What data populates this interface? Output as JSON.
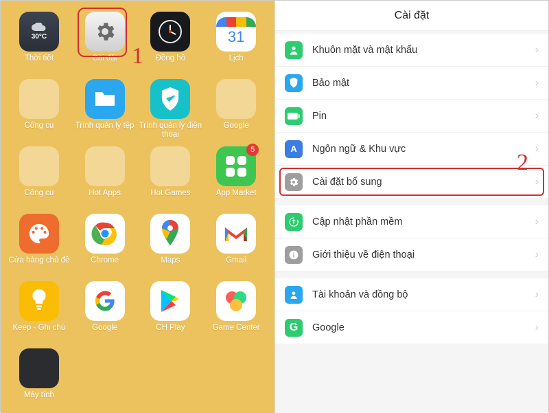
{
  "annotations": {
    "step1": "1",
    "step2": "2"
  },
  "home": {
    "weather_temp": "30°C",
    "calendar_day": "31",
    "badge_appmarket": "5",
    "apps": [
      {
        "label": "Thời tiết"
      },
      {
        "label": "Cài đặt"
      },
      {
        "label": "Đồng hồ"
      },
      {
        "label": "Lịch"
      },
      {
        "label": "Công cụ"
      },
      {
        "label": "Trình quản lý tệp"
      },
      {
        "label": "Trình quản lý điện thoại"
      },
      {
        "label": "Google"
      },
      {
        "label": "Công cụ"
      },
      {
        "label": "Hot Apps"
      },
      {
        "label": "Hot Games"
      },
      {
        "label": "App Market"
      },
      {
        "label": "Cửa hàng chủ đề"
      },
      {
        "label": "Chrome"
      },
      {
        "label": "Maps"
      },
      {
        "label": "Gmail"
      },
      {
        "label": "Keep - Ghi chú"
      },
      {
        "label": "Google"
      },
      {
        "label": "CH Play"
      },
      {
        "label": "Game Center"
      },
      {
        "label": "Máy tính"
      }
    ]
  },
  "settings": {
    "title": "Cài đặt",
    "items": [
      {
        "label": "Khuôn mặt và mật khẩu",
        "icon_color": "#2ecc71"
      },
      {
        "label": "Bảo mật",
        "icon_color": "#2aa7ee"
      },
      {
        "label": "Pin",
        "icon_color": "#2ecc71"
      },
      {
        "label": "Ngôn ngữ & Khu vực",
        "icon_color": "#3b7de0"
      },
      {
        "label": "Cài đặt bổ sung",
        "icon_color": "#9e9e9e",
        "highlight": true
      },
      {
        "label": "Cập nhật phần mềm",
        "icon_color": "#2ecc71"
      },
      {
        "label": "Giới thiệu về điện thoại",
        "icon_color": "#9e9e9e"
      },
      {
        "label": "Tài khoản và đồng bộ",
        "icon_color": "#2aa7ee"
      },
      {
        "label": "Google",
        "icon_color": "#2ecc71"
      }
    ]
  }
}
